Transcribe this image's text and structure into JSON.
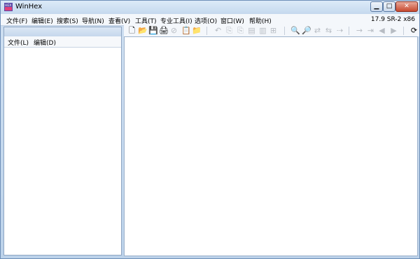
{
  "window": {
    "title": "WinHex",
    "version": "17.9 SR-2 x86",
    "controls": {
      "minimize": "▁",
      "maximize": "□",
      "close": "✕"
    }
  },
  "menu": [
    {
      "label": "文件(F)"
    },
    {
      "label": "编辑(E)"
    },
    {
      "label": "搜索(S)"
    },
    {
      "label": "导航(N)"
    },
    {
      "label": "查看(V)"
    },
    {
      "label": "工具(T)"
    },
    {
      "label": "专业工具(I)"
    },
    {
      "label": "选项(O)"
    },
    {
      "label": "窗口(W)"
    },
    {
      "label": "帮助(H)"
    }
  ],
  "left_pane": {
    "menu": [
      {
        "label": "文件(L)"
      },
      {
        "label": "编辑(D)"
      }
    ]
  },
  "toolbar": [
    {
      "glyph": "🗋",
      "icon": "new-file-icon"
    },
    {
      "glyph": "📂",
      "icon": "open-folder-icon"
    },
    {
      "glyph": "💾",
      "icon": "save-icon"
    },
    {
      "glyph": "🖨",
      "icon": "print-icon"
    },
    {
      "glyph": "⊘",
      "icon": "cancel-icon"
    },
    {
      "glyph": "📋",
      "icon": "properties-icon"
    },
    {
      "glyph": "📁",
      "icon": "open-disk-icon"
    },
    {
      "glyph": "↶",
      "icon": "undo-icon"
    },
    {
      "glyph": "⎘",
      "icon": "copy-icon"
    },
    {
      "glyph": "⎘",
      "icon": "copy-block-icon"
    },
    {
      "glyph": "▤",
      "icon": "paste-icon"
    },
    {
      "glyph": "▥",
      "icon": "write-icon"
    },
    {
      "glyph": "⊞",
      "icon": "fill-icon"
    },
    {
      "glyph": "🔍",
      "icon": "find-text-icon"
    },
    {
      "glyph": "🔎",
      "icon": "find-hex-icon"
    },
    {
      "glyph": "⇄",
      "icon": "replace-text-icon"
    },
    {
      "glyph": "⇆",
      "icon": "replace-hex-icon"
    },
    {
      "glyph": "⇢",
      "icon": "goto-offset-icon"
    },
    {
      "glyph": "→",
      "icon": "goto-next-icon"
    },
    {
      "glyph": "⇥",
      "icon": "goto-end-icon"
    },
    {
      "glyph": "◀",
      "icon": "back-arrow-icon"
    },
    {
      "glyph": "▶",
      "icon": "forward-arrow-icon"
    },
    {
      "glyph": "⟳",
      "icon": "refresh-icon"
    }
  ]
}
